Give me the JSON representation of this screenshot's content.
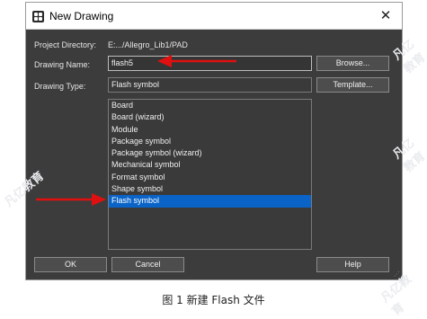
{
  "dialog": {
    "title": "New Drawing",
    "project_directory_label": "Project Directory:",
    "project_directory_value": "E:.../Allegro_Lib1/PAD",
    "drawing_name_label": "Drawing Name:",
    "drawing_name_value": "flash5",
    "browse_label": "Browse...",
    "drawing_type_label": "Drawing Type:",
    "drawing_type_value": "Flash symbol",
    "template_label": "Template...",
    "drawing_types": [
      "Board",
      "Board (wizard)",
      "Module",
      "Package symbol",
      "Package symbol (wizard)",
      "Mechanical symbol",
      "Format symbol",
      "Shape symbol",
      "Flash symbol"
    ],
    "selected_type": "Flash symbol",
    "ok_label": "OK",
    "cancel_label": "Cancel",
    "help_label": "Help"
  },
  "caption": "图 1 新建 Flash 文件",
  "watermark": "凡亿教育",
  "colors": {
    "dialog_background": "#3c3c3c",
    "selection": "#0a64c8",
    "annotation_arrow": "#e01010"
  }
}
